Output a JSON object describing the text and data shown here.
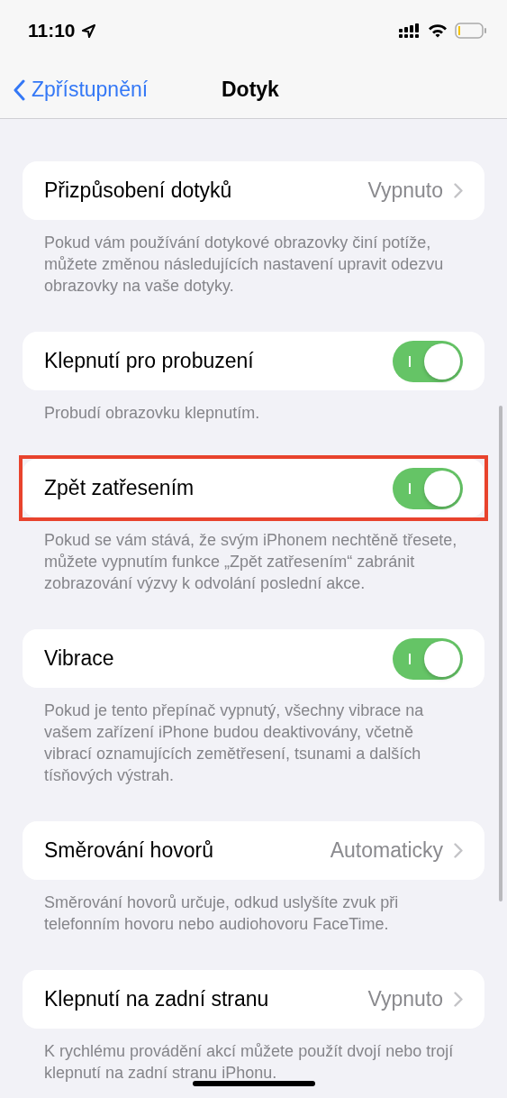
{
  "status_bar": {
    "time": "11:10"
  },
  "nav": {
    "back": "Zpřístupnění",
    "title": "Dotyk"
  },
  "sections": [
    {
      "kind": "value",
      "label": "Přizpůsobení dotyků",
      "value": "Vypnuto",
      "highlighted": false,
      "footer": "Pokud vám používání dotykové obrazovky činí potíže, můžete změnou následujících nastavení upravit odezvu obrazovky na vaše dotyky."
    },
    {
      "kind": "toggle",
      "label": "Klepnutí pro probuzení",
      "on": true,
      "highlighted": false,
      "footer": "Probudí obrazovku klepnutím."
    },
    {
      "kind": "toggle",
      "label": "Zpět zatřesením",
      "on": true,
      "highlighted": true,
      "footer": "Pokud se vám stává, že svým iPhonem nechtěně třesete, můžete vypnutím funkce „Zpět zatřesením“ zabránit zobrazování výzvy k odvolání poslední akce."
    },
    {
      "kind": "toggle",
      "label": "Vibrace",
      "on": true,
      "highlighted": false,
      "footer": "Pokud je tento přepínač vypnutý, všechny vibrace na vašem zařízení iPhone budou deaktivovány, včetně vibrací oznamujících zemětřesení, tsunami a dalších tísňových výstrah."
    },
    {
      "kind": "value",
      "label": "Směrování hovorů",
      "value": "Automaticky",
      "highlighted": false,
      "footer": "Směrování hovorů určuje, odkud uslyšíte zvuk při telefonním hovoru nebo audiohovoru FaceTime."
    },
    {
      "kind": "value",
      "label": "Klepnutí na zadní stranu",
      "value": "Vypnuto",
      "highlighted": false,
      "footer": "K rychlému provádění akcí můžete použít dvojí nebo trojí klepnutí na zadní stranu iPhonu."
    }
  ]
}
